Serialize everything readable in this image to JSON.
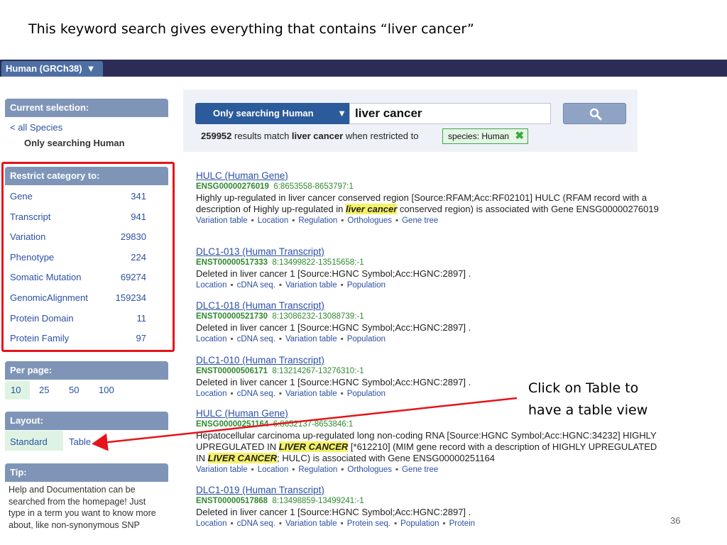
{
  "slide_title": "This keyword search gives everything that contains “liver cancer”",
  "topbar": {
    "species_tab": "Human (GRCh38)",
    "caret": "▼"
  },
  "current_selection": {
    "header": "Current selection:",
    "all_species": "< all Species",
    "only": "Only searching Human"
  },
  "restrict": {
    "header": "Restrict category to:",
    "items": [
      {
        "label": "Gene",
        "count": "341"
      },
      {
        "label": "Transcript",
        "count": "941"
      },
      {
        "label": "Variation",
        "count": "29830"
      },
      {
        "label": "Phenotype",
        "count": "224"
      },
      {
        "label": "Somatic Mutation",
        "count": "69274"
      },
      {
        "label": "GenomicAlignment",
        "count": "159234"
      },
      {
        "label": "Protein Domain",
        "count": "11"
      },
      {
        "label": "Protein Family",
        "count": "97"
      }
    ]
  },
  "per_page": {
    "header": "Per page:",
    "options": [
      "10",
      "25",
      "50",
      "100"
    ]
  },
  "layout": {
    "header": "Layout:",
    "standard": "Standard",
    "table": "Table"
  },
  "tip": {
    "header": "Tip:",
    "text": "Help and Documentation can be searched from the homepage! Just type in a term you want to know more about, like non-synonymous SNP"
  },
  "search": {
    "scope": "Only searching Human",
    "caret": "▼",
    "query": "liver cancer",
    "count": "259952",
    "count_mid": " results match ",
    "count_term": "liver cancer",
    "count_tail": " when restricted to",
    "filter": "species: Human",
    "filter_x": "✖"
  },
  "results": [
    {
      "title": "HULC (Human Gene)",
      "id": "ENSG00000276019",
      "loc": "6:8653558-8653797:1",
      "desc_html": "Highly up-regulated in liver cancer conserved region [Source:RFAM;Acc:RF02101] HULC (RFAM record with a description of Highly up-regulated in <span class=\"hl\">liver cancer</span> conserved region) is associated with Gene ENSG00000276019",
      "links": [
        "Variation table",
        "Location",
        "Regulation",
        "Orthologues",
        "Gene tree"
      ]
    },
    {
      "title": "DLC1-013 (Human Transcript)",
      "id": "ENST00000517333",
      "loc": "8:13499822-13515658:-1",
      "desc_html": "Deleted in liver cancer 1 [Source:HGNC Symbol;Acc:HGNC:2897] .",
      "links": [
        "Location",
        "cDNA seq.",
        "Variation table",
        "Population"
      ]
    },
    {
      "title": "DLC1-018 (Human Transcript)",
      "id": "ENST00000521730",
      "loc": "8:13086232-13088739:-1",
      "desc_html": "Deleted in liver cancer 1 [Source:HGNC Symbol;Acc:HGNC:2897] .",
      "links": [
        "Location",
        "cDNA seq.",
        "Variation table",
        "Population"
      ]
    },
    {
      "title": "DLC1-010 (Human Transcript)",
      "id": "ENST00000506171",
      "loc": "8:13214267-13276310:-1",
      "desc_html": "Deleted in liver cancer 1 [Source:HGNC Symbol;Acc:HGNC:2897] .",
      "links": [
        "Location",
        "cDNA seq.",
        "Variation table",
        "Population"
      ]
    },
    {
      "title": "HULC (Human Gene)",
      "id": "ENSG00000251164",
      "loc": "6:8652137-8653846:1",
      "desc_html": "Hepatocellular carcinoma up-regulated long non-coding RNA [Source:HGNC Symbol;Acc:HGNC:34232] HIGHLY UPREGULATED IN <span class=\"hl\">LIVER CANCER</span> [*612210] (MIM gene record with a description of HIGHLY UPREGULATED IN <span class=\"hl\">LIVER CANCER</span>; HULC) is associated with Gene ENSG00000251164",
      "links": [
        "Variation table",
        "Location",
        "Regulation",
        "Orthologues",
        "Gene tree"
      ]
    },
    {
      "title": "DLC1-019 (Human Transcript)",
      "id": "ENST00000517868",
      "loc": "8:13498859-13499241:-1",
      "desc_html": "Deleted in liver cancer 1 [Source:HGNC Symbol;Acc:HGNC:2897] .",
      "links": [
        "Location",
        "cDNA seq.",
        "Variation table",
        "Protein seq.",
        "Population",
        "Protein"
      ]
    }
  ],
  "callout": {
    "line1": "Click on Table to",
    "line2": "have a table view"
  },
  "page_number": "36",
  "colors": {
    "annotation_red": "#e5141b",
    "nav_dark": "#2b2d57",
    "panel_blue": "#7f95b8"
  }
}
